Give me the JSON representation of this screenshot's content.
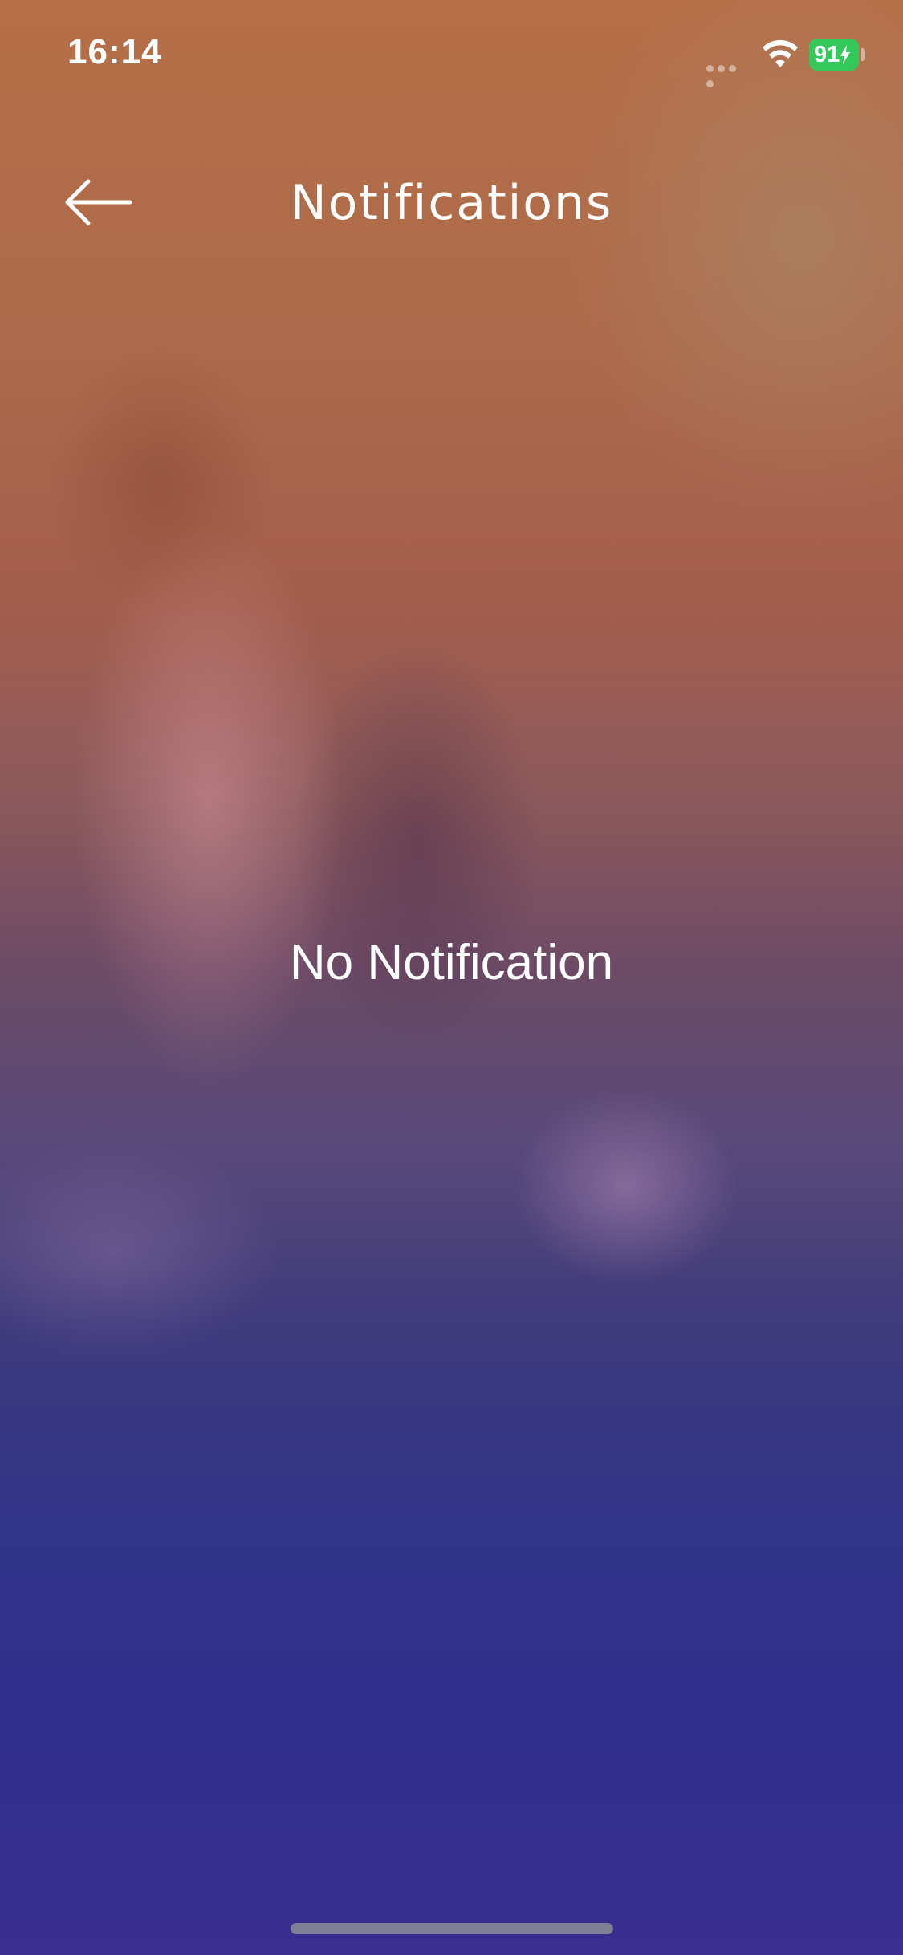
{
  "status_bar": {
    "time": "16:14",
    "battery_level": "91",
    "battery_charging": true,
    "battery_color": "#34c759",
    "icons": [
      "cellular-signal-icon",
      "wifi-icon",
      "battery-charging-icon"
    ]
  },
  "header": {
    "back_icon": "arrow-left-icon",
    "title": "Notifications"
  },
  "main": {
    "empty_message": "No Notification"
  },
  "colors": {
    "text": "#ffffff",
    "gradient_top": "#b66f48",
    "gradient_bottom": "#3a2e8e"
  }
}
